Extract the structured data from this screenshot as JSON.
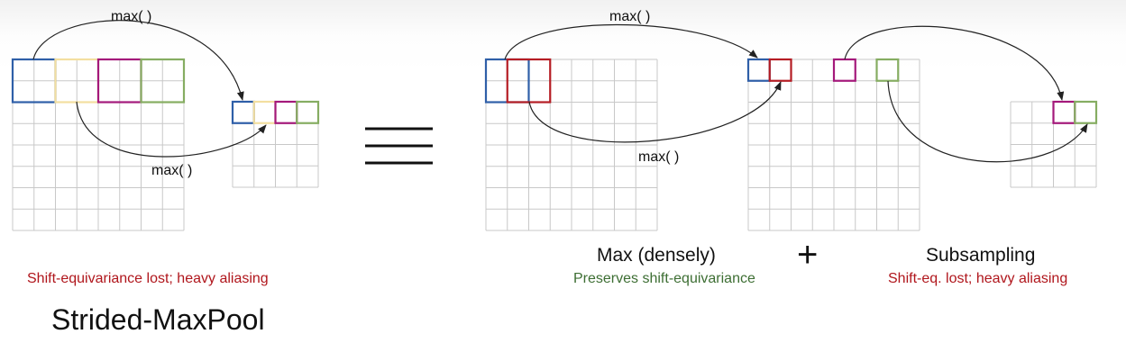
{
  "colors": {
    "grid": "#c8c8c8",
    "blue": "#2f5fa8",
    "yellow": "#f3dfa0",
    "purple": "#a4197b",
    "green": "#86ad62",
    "red": "#b51d24",
    "lost_text": "#b0161c",
    "preserve_text": "#3d6e33",
    "arrow": "#222222"
  },
  "left": {
    "max_top": "max( )",
    "max_bottom": "max( )",
    "note": "Shift-equivariance lost; heavy aliasing",
    "title": "Strided-MaxPool"
  },
  "equiv_symbol": "equivalence-icon",
  "right": {
    "max_top": "max( )",
    "max_bottom": "max( )",
    "max_heading": "Max (densely)",
    "max_note": "Preserves shift-equivariance",
    "plus": "+",
    "sub_heading": "Subsampling",
    "sub_note": "Shift-eq. lost; heavy aliasing"
  }
}
